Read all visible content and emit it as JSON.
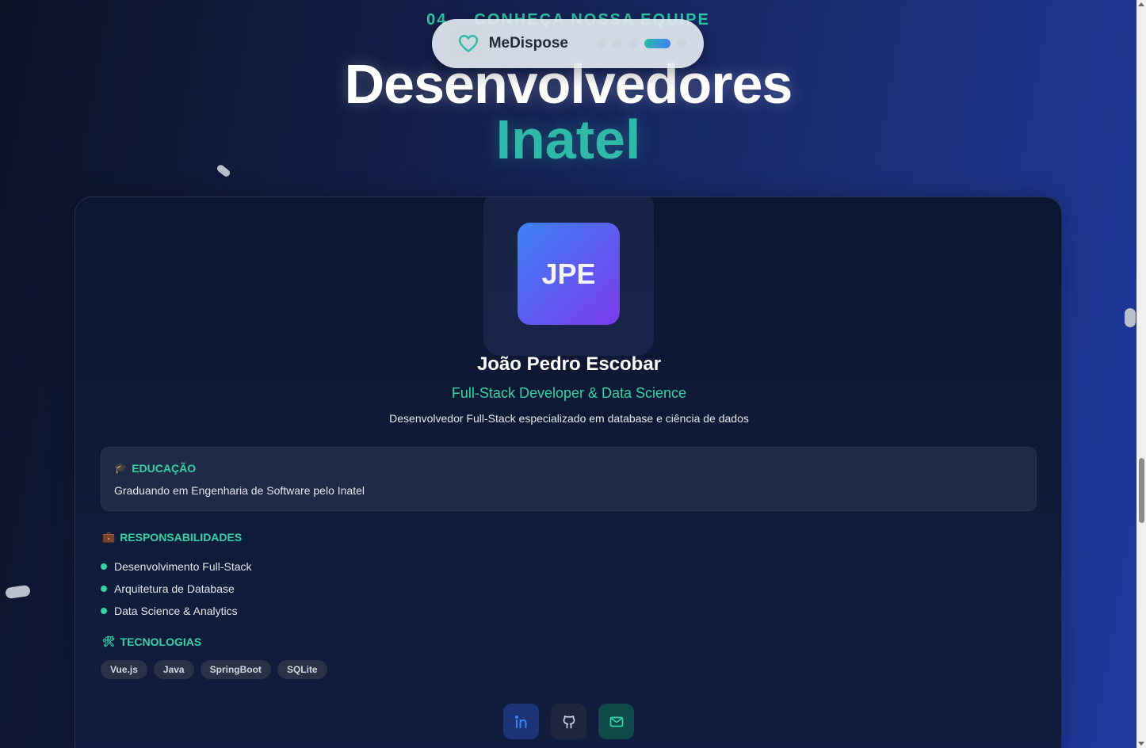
{
  "section": {
    "number": "04",
    "eyebrow": "CONHEÇA NOSSA EQUIPE",
    "title_line1": "Desenvolvedores",
    "title_line2": "Inatel",
    "subtitle": ""
  },
  "navbar": {
    "brand": "MeDispose",
    "logo_icon": "heart-icon",
    "section_dots": 5,
    "active_dot": 4
  },
  "developer": {
    "initials": "JPE",
    "name": "João Pedro Escobar",
    "role": "Full-Stack Developer & Data Science",
    "description": "Desenvolvedor Full-Stack especializado em database e ciência de dados",
    "education": {
      "icon": "graduation-cap-icon",
      "heading": "EDUCAÇÃO",
      "text": "Graduando em Engenharia de Software pelo Inatel"
    },
    "responsibilities": {
      "icon": "briefcase-icon",
      "heading": "RESPONSABILIDADES",
      "items": [
        "Desenvolvimento Full-Stack",
        "Arquitetura de Database",
        "Data Science & Analytics"
      ]
    },
    "technologies": {
      "icon": "tools-icon",
      "heading": "TECNOLOGIAS",
      "tags": [
        "Vue.js",
        "Java",
        "SpringBoot",
        "SQLite"
      ]
    },
    "social": [
      {
        "name": "linkedin-icon",
        "color": "#3b82f6"
      },
      {
        "name": "github-icon",
        "color": "#cbd5e1"
      },
      {
        "name": "mail-icon",
        "color": "#34d3a6"
      }
    ]
  },
  "colors": {
    "accent": "#34d3a6",
    "title_accent": "#2fb9a9",
    "avatar_start": "#3b82f6",
    "avatar_end": "#7c3aed"
  }
}
